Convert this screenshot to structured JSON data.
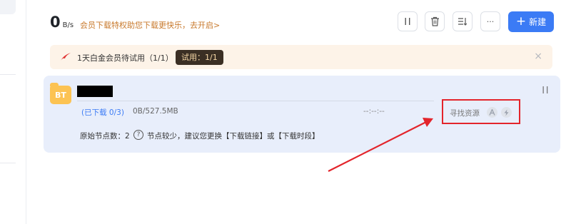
{
  "header": {
    "speed_value": "0",
    "speed_unit": "B/s",
    "vip_promo": "会员下载特权助您下载更快乐，去开启>"
  },
  "toolbar": {
    "new_label": "新建",
    "pause_all_icon": "pause-icon",
    "delete_icon": "trash-icon",
    "sort_icon": "list-sort-icon",
    "more_label": "···"
  },
  "trial_banner": {
    "text": "1天白金会员待试用（1/1）",
    "badge": "试用：1/1",
    "close": "×"
  },
  "task": {
    "type_label": "BT",
    "status": "(已下载 0/3)",
    "size": "0B/527.5MB",
    "time_remaining": "--:--:--",
    "find_resources": "寻找资源",
    "nodes_label": "原始节点数：2",
    "help": "?",
    "nodes_tip": "节点较少，建议您更换【下载链接】或【下载时段】"
  },
  "colors": {
    "accent": "#3b7bf5",
    "promo": "#c8792c",
    "annotation": "#e3242b",
    "card_bg": "#e8eefb",
    "trial_bg": "#fdf3e8"
  }
}
